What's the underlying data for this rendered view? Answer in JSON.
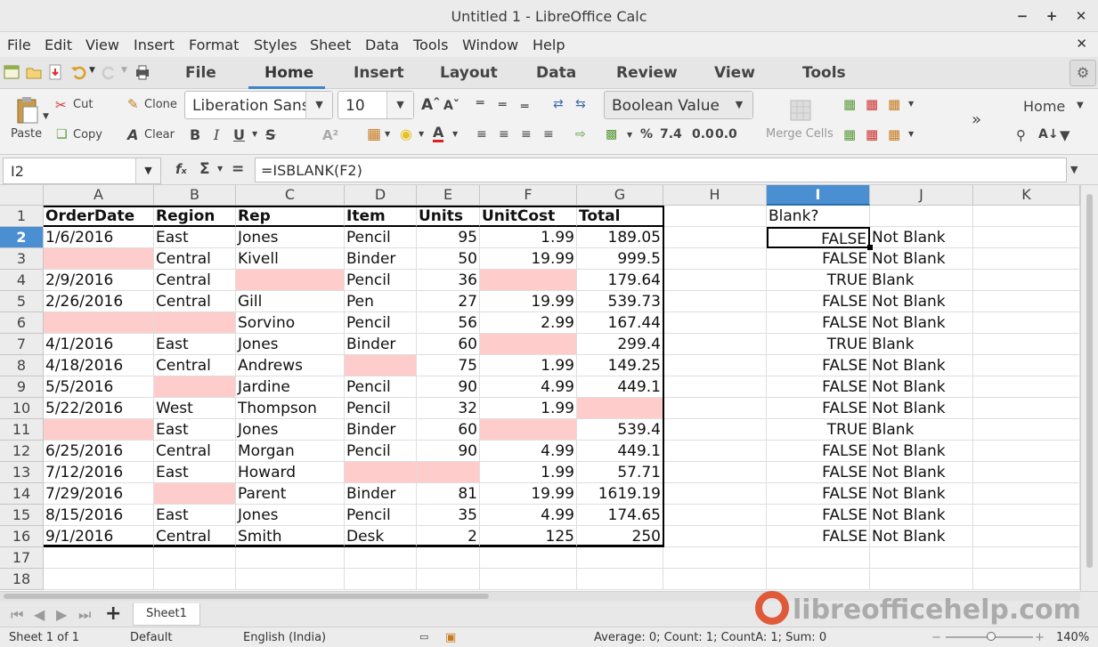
{
  "window": {
    "title": "Untitled 1 - LibreOffice Calc"
  },
  "menu": [
    "File",
    "Edit",
    "View",
    "Insert",
    "Format",
    "Styles",
    "Sheet",
    "Data",
    "Tools",
    "Window",
    "Help"
  ],
  "tabs": [
    "File",
    "Home",
    "Insert",
    "Layout",
    "Data",
    "Review",
    "View",
    "Tools"
  ],
  "active_tab": "Home",
  "ribbon": {
    "cut": "Cut",
    "copy": "Copy",
    "paste": "Paste",
    "clone": "Clone",
    "clear": "Clear",
    "font_name": "Liberation Sans",
    "font_size": "10",
    "cell_style": "Boolean Value",
    "merge_cells": "Merge Cells",
    "home_dropdown": "Home",
    "percent": "%",
    "decimal_format": "7.4",
    "add_decimal": "0.0",
    "del_decimal": "0.0"
  },
  "formula_bar": {
    "name_box": "I2",
    "formula": "=ISBLANK(F2)"
  },
  "columns": [
    "A",
    "B",
    "C",
    "D",
    "E",
    "F",
    "G",
    "H",
    "I",
    "J",
    "K"
  ],
  "selected_column": "I",
  "selected_row": "2",
  "rows": [
    "1",
    "2",
    "3",
    "4",
    "5",
    "6",
    "7",
    "8",
    "9",
    "10",
    "11",
    "12",
    "13",
    "14",
    "15",
    "16",
    "17",
    "18"
  ],
  "headers": [
    "OrderDate",
    "Region",
    "Rep",
    "Item",
    "Units",
    "UnitCost",
    "Total"
  ],
  "data": [
    [
      "1/6/2016",
      "East",
      "Jones",
      "Pencil",
      "95",
      "1.99",
      "189.05"
    ],
    [
      "",
      "Central",
      "Kivell",
      "Binder",
      "50",
      "19.99",
      "999.5"
    ],
    [
      "2/9/2016",
      "Central",
      "",
      "Pencil",
      "36",
      "",
      "179.64"
    ],
    [
      "2/26/2016",
      "Central",
      "Gill",
      "Pen",
      "27",
      "19.99",
      "539.73"
    ],
    [
      "",
      "",
      "Sorvino",
      "Pencil",
      "56",
      "2.99",
      "167.44"
    ],
    [
      "4/1/2016",
      "East",
      "Jones",
      "Binder",
      "60",
      "",
      "299.4"
    ],
    [
      "4/18/2016",
      "Central",
      "Andrews",
      "",
      "75",
      "1.99",
      "149.25"
    ],
    [
      "5/5/2016",
      "",
      "Jardine",
      "Pencil",
      "90",
      "4.99",
      "449.1"
    ],
    [
      "5/22/2016",
      "West",
      "Thompson",
      "Pencil",
      "32",
      "1.99",
      ""
    ],
    [
      "",
      "East",
      "Jones",
      "Binder",
      "60",
      "",
      "539.4"
    ],
    [
      "6/25/2016",
      "Central",
      "Morgan",
      "Pencil",
      "90",
      "4.99",
      "449.1"
    ],
    [
      "7/12/2016",
      "East",
      "Howard",
      "",
      "",
      "1.99",
      "57.71"
    ],
    [
      "7/29/2016",
      "",
      "Parent",
      "Binder",
      "81",
      "19.99",
      "1619.19"
    ],
    [
      "8/15/2016",
      "East",
      "Jones",
      "Pencil",
      "35",
      "4.99",
      "174.65"
    ],
    [
      "9/1/2016",
      "Central",
      "Smith",
      "Desk",
      "2",
      "125",
      "250"
    ]
  ],
  "blank_header": "Blank?",
  "results": [
    [
      "FALSE",
      "Not Blank"
    ],
    [
      "FALSE",
      "Not Blank"
    ],
    [
      "TRUE",
      "Blank"
    ],
    [
      "FALSE",
      "Not Blank"
    ],
    [
      "FALSE",
      "Not Blank"
    ],
    [
      "TRUE",
      "Blank"
    ],
    [
      "FALSE",
      "Not Blank"
    ],
    [
      "FALSE",
      "Not Blank"
    ],
    [
      "FALSE",
      "Not Blank"
    ],
    [
      "TRUE",
      "Blank"
    ],
    [
      "FALSE",
      "Not Blank"
    ],
    [
      "FALSE",
      "Not Blank"
    ],
    [
      "FALSE",
      "Not Blank"
    ],
    [
      "FALSE",
      "Not Blank"
    ],
    [
      "FALSE",
      "Not Blank"
    ]
  ],
  "highlight_color": "#ffcccc",
  "sheet_tab": "Sheet1",
  "status": {
    "sheet": "Sheet 1 of 1",
    "style": "Default",
    "language": "English (India)",
    "summary": "Average: 0; Count: 1; CountA: 1; Sum: 0",
    "zoom": "140%"
  },
  "watermark": "libreofficehelp.com"
}
